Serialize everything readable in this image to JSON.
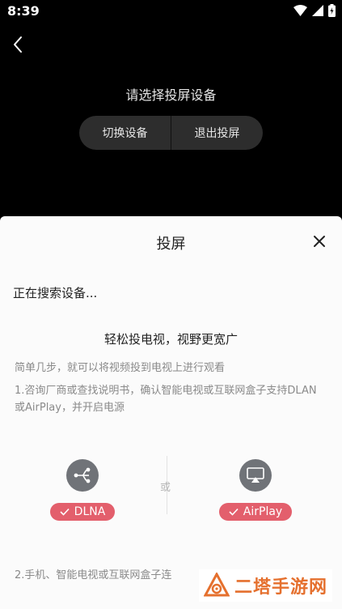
{
  "status_bar": {
    "time": "8:39"
  },
  "header": {
    "prompt": "请选择投屏设备",
    "switch_label": "切换设备",
    "exit_label": "退出投屏"
  },
  "sheet": {
    "title": "投屏",
    "searching": "正在搜索设备...",
    "promo": "轻松投电视，视野更宽广",
    "steps_intro": "简单几步，就可以将视频投到电视上进行观看",
    "step1": "1.咨询厂商或查找说明书，确认智能电视或互联网盒子支持DLAN或AirPlay，并开启电源",
    "protocols": {
      "dlna_label": "DLNA",
      "or_label": "或",
      "airplay_label": "AirPlay"
    },
    "step2": "2.手机、智能电视或互联网盒子连"
  },
  "watermark": {
    "text": "二塔手游网"
  },
  "colors": {
    "badge": "#e35f6c",
    "icon_circle": "#707378",
    "watermark": "#e5702e"
  }
}
